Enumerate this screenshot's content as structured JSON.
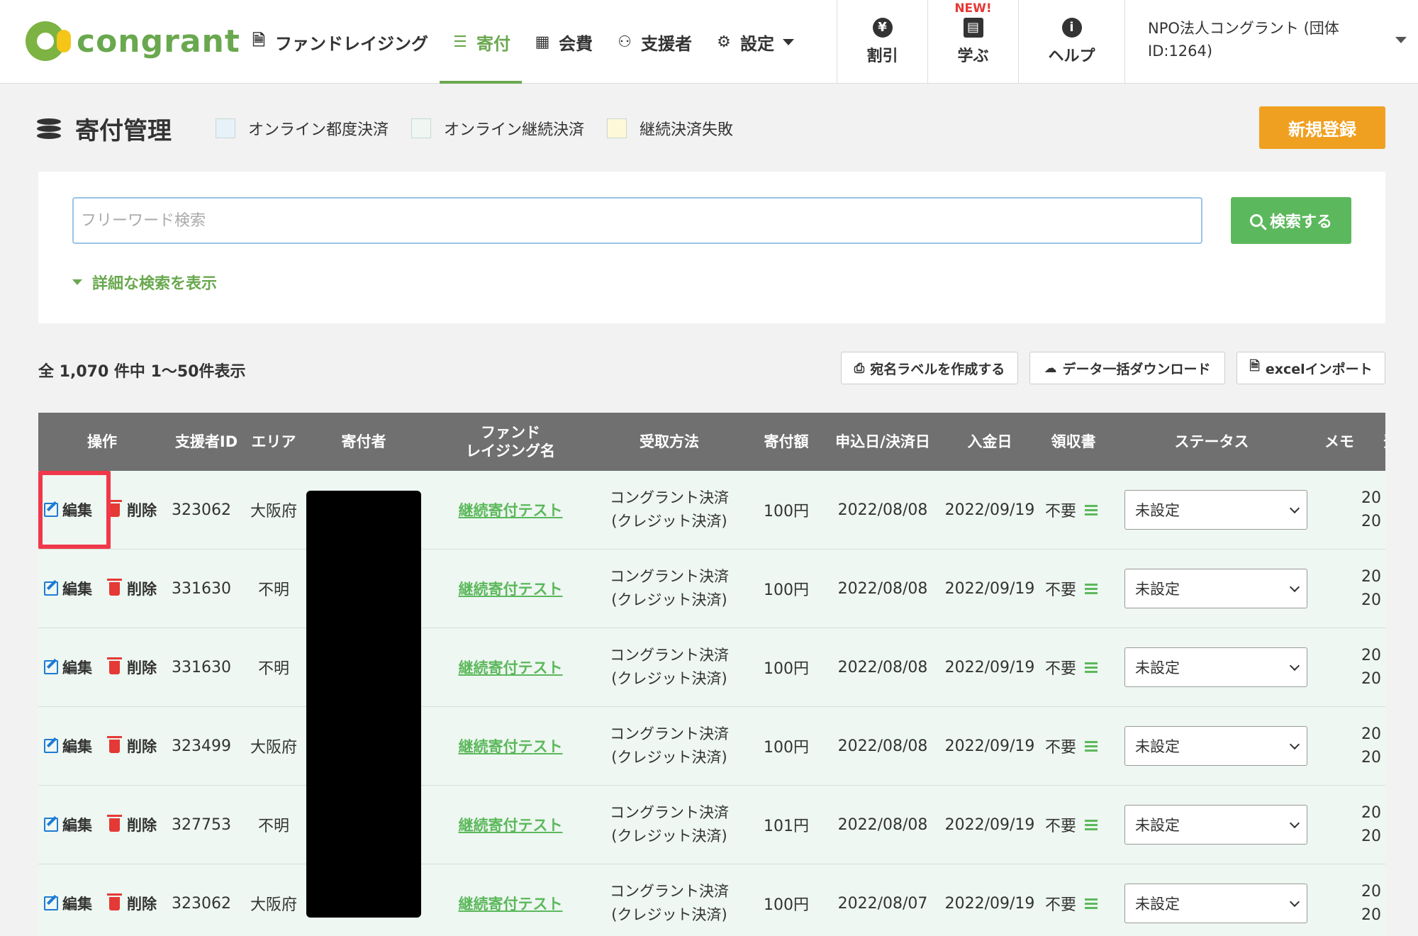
{
  "header": {
    "logo_text": "congrant",
    "nav": [
      {
        "label": "ファンドレイジング",
        "icon": "document-icon"
      },
      {
        "label": "寄付",
        "icon": "coins-icon",
        "active": true
      },
      {
        "label": "会費",
        "icon": "id-card-icon"
      },
      {
        "label": "支援者",
        "icon": "users-icon"
      },
      {
        "label": "設定",
        "icon": "gear-icon"
      }
    ],
    "tools": [
      {
        "label": "割引",
        "icon": "yen-shield-icon"
      },
      {
        "label": "学ぶ",
        "icon": "book-icon",
        "badge": "NEW!"
      },
      {
        "label": "ヘルプ",
        "icon": "info-icon"
      }
    ],
    "account": "NPO法人コングラント (団体ID:1264)"
  },
  "page": {
    "title": "寄付管理",
    "legend": [
      {
        "label": "オンライン都度決済",
        "color": "#e6f1f8"
      },
      {
        "label": "オンライン継続決済",
        "color": "#eef7f1"
      },
      {
        "label": "継続決済失敗",
        "color": "#fdf8d8"
      }
    ],
    "new_button": "新規登録"
  },
  "search": {
    "placeholder": "フリーワード検索",
    "button": "検索する",
    "advanced_toggle": "詳細な検索を表示"
  },
  "results": {
    "count_text": "全 1,070 件中 1〜50件表示",
    "actions": [
      {
        "label": "宛名ラベルを作成する",
        "icon": "printer-icon"
      },
      {
        "label": "データ一括ダウンロード",
        "icon": "cloud-download-icon"
      },
      {
        "label": "excelインポート",
        "icon": "file-import-icon"
      }
    ]
  },
  "table": {
    "columns": [
      "操作",
      "支援者ID",
      "エリア",
      "寄付者",
      "ファンド\nレイジング名",
      "受取方法",
      "寄付額",
      "申込日/決済日",
      "入金日",
      "領収書",
      "ステータス",
      "メモ",
      "登"
    ],
    "edit_label": "編集",
    "delete_label": "削除",
    "rows": [
      {
        "id": "323062",
        "area": "大阪府",
        "fund": "継続寄付テスト",
        "method1": "コングラント決済",
        "method2": "(クレジット決済)",
        "amount": "100円",
        "date": "2022/08/08",
        "paid": "2022/09/19",
        "receipt": "不要",
        "status": "未設定",
        "reg1": "20",
        "reg2": "20"
      },
      {
        "id": "331630",
        "area": "不明",
        "fund": "継続寄付テスト",
        "method1": "コングラント決済",
        "method2": "(クレジット決済)",
        "amount": "100円",
        "date": "2022/08/08",
        "paid": "2022/09/19",
        "receipt": "不要",
        "status": "未設定",
        "reg1": "20",
        "reg2": "20"
      },
      {
        "id": "331630",
        "area": "不明",
        "fund": "継続寄付テスト",
        "method1": "コングラント決済",
        "method2": "(クレジット決済)",
        "amount": "100円",
        "date": "2022/08/08",
        "paid": "2022/09/19",
        "receipt": "不要",
        "status": "未設定",
        "reg1": "20",
        "reg2": "20"
      },
      {
        "id": "323499",
        "area": "大阪府",
        "fund": "継続寄付テスト",
        "method1": "コングラント決済",
        "method2": "(クレジット決済)",
        "amount": "100円",
        "date": "2022/08/08",
        "paid": "2022/09/19",
        "receipt": "不要",
        "status": "未設定",
        "reg1": "20",
        "reg2": "20"
      },
      {
        "id": "327753",
        "area": "不明",
        "fund": "継続寄付テスト",
        "method1": "コングラント決済",
        "method2": "(クレジット決済)",
        "amount": "101円",
        "date": "2022/08/08",
        "paid": "2022/09/19",
        "receipt": "不要",
        "status": "未設定",
        "reg1": "20",
        "reg2": "20"
      },
      {
        "id": "323062",
        "area": "大阪府",
        "fund": "継続寄付テスト",
        "method1": "コングラント決済",
        "method2": "(クレジット決済)",
        "amount": "100円",
        "date": "2022/08/07",
        "paid": "2022/09/19",
        "receipt": "不要",
        "status": "未設定",
        "reg1": "20",
        "reg2": "20"
      }
    ]
  },
  "colors": {
    "brand_green": "#6aa84f",
    "orange": "#f0a020",
    "search_green": "#5cb85c",
    "header_gray": "#707070",
    "highlight_red": "#f0384a"
  }
}
